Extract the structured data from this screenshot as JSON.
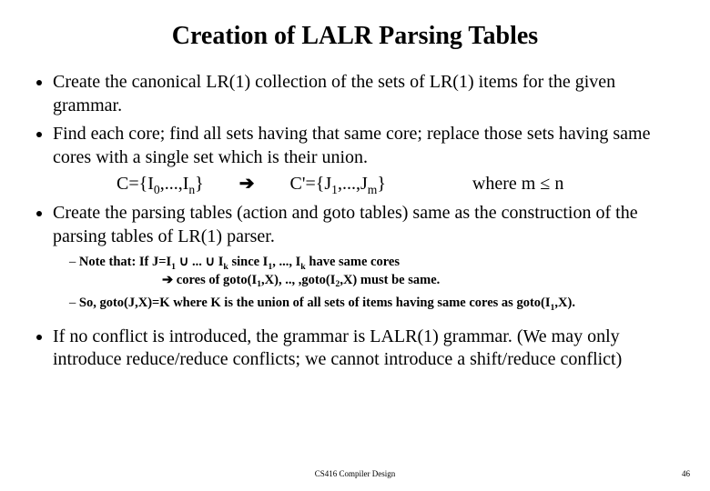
{
  "title": "Creation of LALR Parsing Tables",
  "bullets": {
    "b1": "Create the canonical LR(1) collection of the sets of LR(1) items for the given grammar.",
    "b2": "Find each core; find all sets having that same core; replace those sets having same cores with a single set which is their union.",
    "eq_c": "C={I",
    "eq_c_sub0": "0",
    "eq_c_mid": ",...,I",
    "eq_c_subn": "n",
    "eq_c_close": "}",
    "arrow": "➔",
    "eq_cp": "C'={J",
    "eq_cp_sub1": "1",
    "eq_cp_mid": ",...,J",
    "eq_cp_subm": "m",
    "eq_cp_close": "}",
    "where": "where m ≤ n",
    "b3": "Create the parsing tables (action and goto tables) same as the construction of the parsing tables of LR(1) parser.",
    "note_lead": "Note that:   If J=I",
    "note_s1": "1",
    "note_cup": " ∪ ... ∪ I",
    "note_sk": "k",
    "note_since": "  since I",
    "note_s1b": "1",
    "note_dots": ", ..., I",
    "note_skb": "k",
    "note_tail": " have same cores",
    "cores_arrow": "➔",
    "cores_a": " cores of goto(I",
    "cores_sa": "1",
    "cores_b": ",X), .., ,goto(I",
    "cores_sb": "2",
    "cores_c": ",X) must be same.",
    "so_a": "So, goto(J,X)=K  where K is the union of all sets of items having same cores as goto(I",
    "so_s1": "1",
    "so_b": ",X).",
    "b4": "If no conflict is introduced, the grammar is LALR(1) grammar. (We may only introduce reduce/reduce conflicts; we cannot introduce a shift/reduce conflict)"
  },
  "footer": "CS416 Compiler Design",
  "page": "46"
}
